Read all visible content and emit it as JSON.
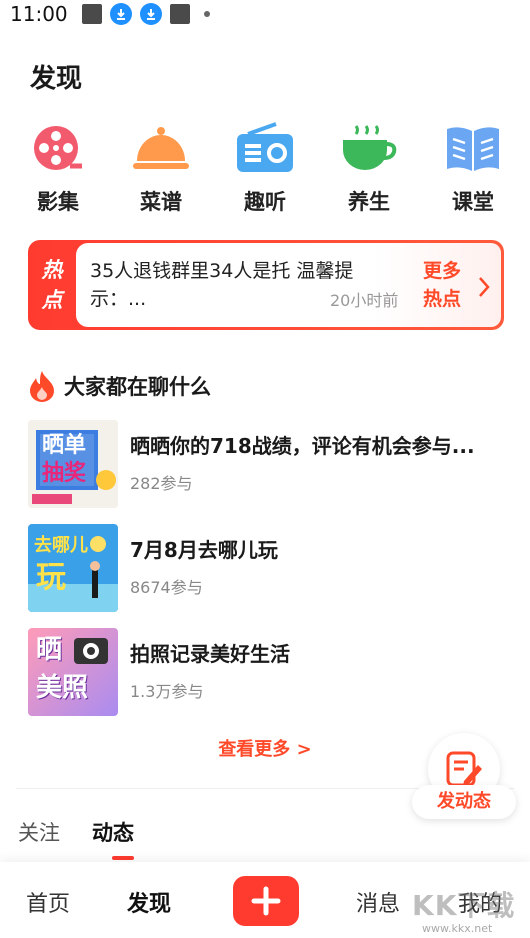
{
  "status_bar": {
    "time": "11:00"
  },
  "page_title": "发现",
  "categories": [
    {
      "label": "影集",
      "icon": "film-reel-icon",
      "color": "#f25b6d"
    },
    {
      "label": "菜谱",
      "icon": "food-cloche-icon",
      "color": "#ff9a4d"
    },
    {
      "label": "趣听",
      "icon": "radio-icon",
      "color": "#4aa8f0"
    },
    {
      "label": "养生",
      "icon": "tea-cup-icon",
      "color": "#3cb85a"
    },
    {
      "label": "课堂",
      "icon": "open-book-icon",
      "color": "#6aa6f2"
    }
  ],
  "hot": {
    "tag_line1": "热",
    "tag_line2": "点",
    "text": "35人退钱群里34人是托 温馨提示：...",
    "time": "20小时前",
    "more_line1": "更多",
    "more_line2": "热点"
  },
  "chat": {
    "title": "大家都在聊什么",
    "topics": [
      {
        "title": "晒晒你的718战绩，评论有机会参与...",
        "count": "282参与",
        "thumb_line1": "晒单",
        "thumb_line2": "抽奖"
      },
      {
        "title": "7月8月去哪儿玩",
        "count": "8674参与",
        "thumb_line1": "去哪儿",
        "thumb_line2": "玩"
      },
      {
        "title": "拍照记录美好生活",
        "count": "1.3万参与",
        "thumb_line1": "晒",
        "thumb_line2": "美照"
      }
    ],
    "see_more": "查看更多 >"
  },
  "fab": {
    "label": "发动态"
  },
  "feed_tabs": [
    {
      "label": "关注"
    },
    {
      "label": "动态"
    }
  ],
  "bottom_nav": [
    {
      "label": "首页"
    },
    {
      "label": "发现"
    },
    {
      "label": "消息"
    },
    {
      "label": "我的"
    }
  ],
  "watermark": {
    "text": "KK下载",
    "url": "www.kkx.net"
  },
  "colors": {
    "accent": "#ff3b30",
    "accent_text": "#ff4a2a"
  }
}
